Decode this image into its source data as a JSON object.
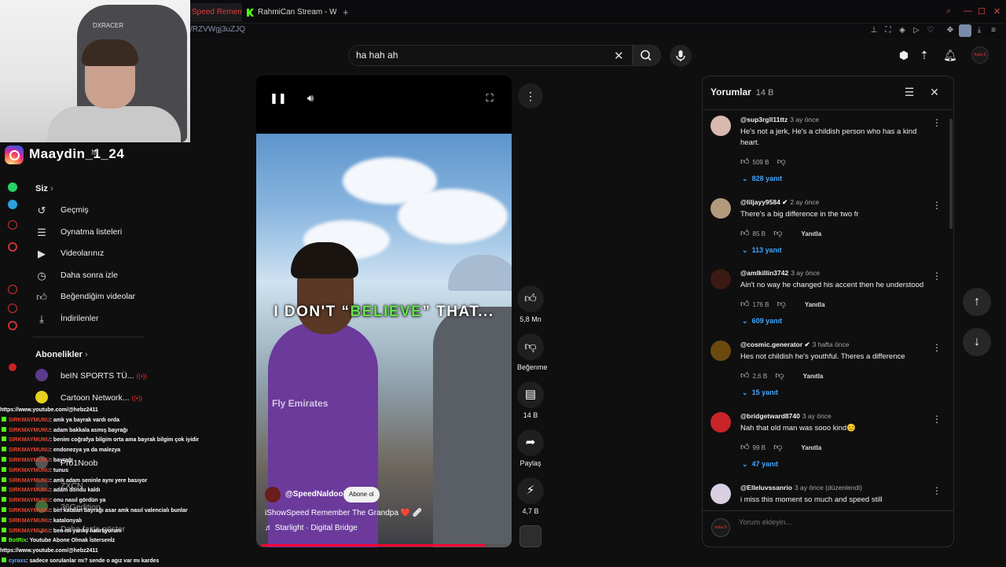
{
  "browser": {
    "tabs": [
      {
        "label": "Speed Rememb"
      },
      {
        "label": "RahmiCan Stream - Watc"
      }
    ],
    "new_tab": "+",
    "url": "/RZVWgj3uZJQ"
  },
  "webcam": {
    "chair_logo": "DXRACER",
    "instagram_handle": "Maaydin_1_24",
    "partial_text": "M"
  },
  "header": {
    "search_value": "ha hah ah",
    "profile_label": "hebz.0"
  },
  "guide": {
    "you_header": "Siz",
    "items": [
      {
        "label": "Geçmiş",
        "icon": "history-icon"
      },
      {
        "label": "Oynatma listeleri",
        "icon": "playlist-icon"
      },
      {
        "label": "Videolarınız",
        "icon": "video-icon"
      },
      {
        "label": "Daha sonra izle",
        "icon": "clock-icon"
      },
      {
        "label": "Beğendiğim videolar",
        "icon": "like-icon"
      },
      {
        "label": "İndirilenler",
        "icon": "download-icon"
      }
    ],
    "subs_header": "Abonelikler",
    "subscriptions": [
      {
        "label": "beIN SPORTS TÜ...",
        "live": "((•))"
      },
      {
        "label": "Cartoon Network...",
        "live": "((•))"
      },
      {
        "label": "Pro1Noob",
        "live": ""
      },
      {
        "label": "ZXCN",
        "live": ""
      },
      {
        "label": "36Gedition",
        "live": ""
      },
      {
        "label": "Daha fazla göster",
        "live": ""
      }
    ]
  },
  "chat": [
    {
      "user": "",
      "msg": "https://www.youtube.com/@hebz2411"
    },
    {
      "user": "SIRKMAYMUNU",
      "msg": ": amk ya bayrak vardı orda"
    },
    {
      "user": "SIRKMAYMUNU",
      "msg": ": adam bakkala asmış bayrağı"
    },
    {
      "user": "SIRKMAYMUNU",
      "msg": ": benim coğrafya bilgim orta ama bayrak bilgim çok iyidir"
    },
    {
      "user": "SIRKMAYMUNU",
      "msg": ": endonezya ya da malezya"
    },
    {
      "user": "SIRKMAYMUNU",
      "msg": ": bayrağı"
    },
    {
      "user": "SIRKMAYMUNU",
      "msg": ": tunus"
    },
    {
      "user": "SIRKMAYMUNU",
      "msg": ": amk adam seninle aynı yere basıyor"
    },
    {
      "user": "SIRKMAYMUNU",
      "msg": ": adam dondu kaldı"
    },
    {
      "user": "SIRKMAYMUNU",
      "msg": ": onu nasıl gördün ya"
    },
    {
      "user": "SIRKMAYMUNU",
      "msg": ": biri katalan bayrağı asar amk nasıl valencialı bunlar"
    },
    {
      "user": "SIRKMAYMUNU",
      "msg": ": katalonyalı"
    },
    {
      "user": "SIRKMAYMUNU",
      "msg": ": ben mi yanlış hatırlıyorum"
    },
    {
      "user": "BotRix",
      "msg": ": Youtube Abone Olmak İstersenİz"
    },
    {
      "user": "",
      "msg": "https://www.youtube.com/@hebz2411"
    },
    {
      "user": "cyraxs",
      "msg": ": sadece sorulanlar mı? sende o agız var mı kardes"
    }
  ],
  "player": {
    "caption_pre": "I DON'T “",
    "caption_hl": "BELIEVE",
    "caption_post": "” THAT...",
    "channel": "@SpeedNaldoo7",
    "subscribe": "Abone ol",
    "title": "iShowSpeed Remember The Grandpa ❤️ 🩹",
    "music": "♬ Starlight · Digital Bridge",
    "progress": 0.91,
    "jersey_text": "Fly Emirates"
  },
  "actions": {
    "like_count": "5,8 Mn",
    "dislike_label": "Beğenme",
    "comment_count": "14 B",
    "share_label": "Paylaş",
    "remix_count": "4,7 B"
  },
  "comments": {
    "title": "Yorumlar",
    "count": "14 B",
    "add_placeholder": "Yorum ekleyin...",
    "reply_label": "Yanıtla",
    "items": [
      {
        "user": "@sup3rgll11ttz",
        "time": "3 ay önce",
        "text": "He's not a jerk, He's a childish person who has a kind heart.",
        "likes": "509 B",
        "show_reply": false,
        "replies": "828 yanıt",
        "avatar": "#d9b8b0"
      },
      {
        "user": "@liljayy9584 ✔",
        "time": "2 ay önce",
        "text": "There's a big difference in the two fr",
        "likes": "85 B",
        "show_reply": true,
        "replies": "113 yanıt",
        "avatar": "#b49a7c"
      },
      {
        "user": "@amlkillin3742",
        "time": "3 ay önce",
        "text": "Ain't no way he changed his accent then he understood",
        "likes": "176 B",
        "show_reply": true,
        "replies": "609 yanıt",
        "avatar": "#3a1a12"
      },
      {
        "user": "@cosmic.generator ✔",
        "time": "3 hafta önce",
        "text": "Hes not childish he's youthful. Theres a difference",
        "likes": "2,6 B",
        "show_reply": true,
        "replies": "15 yanıt",
        "avatar": "#6b4a10"
      },
      {
        "user": "@bridgetward8740",
        "time": "3 ay önce",
        "text": "Nah that old man was sooo kind😊",
        "likes": "99 B",
        "show_reply": true,
        "replies": "47 yanıt",
        "avatar": "#c8242a"
      },
      {
        "user": "@Elleluvssanrio",
        "time": "3 ay önce (düzenlendi)",
        "text": "i miss this moment so much and speed still",
        "likes": "",
        "show_reply": false,
        "replies": "",
        "avatar": "#d8d0e0"
      }
    ]
  }
}
